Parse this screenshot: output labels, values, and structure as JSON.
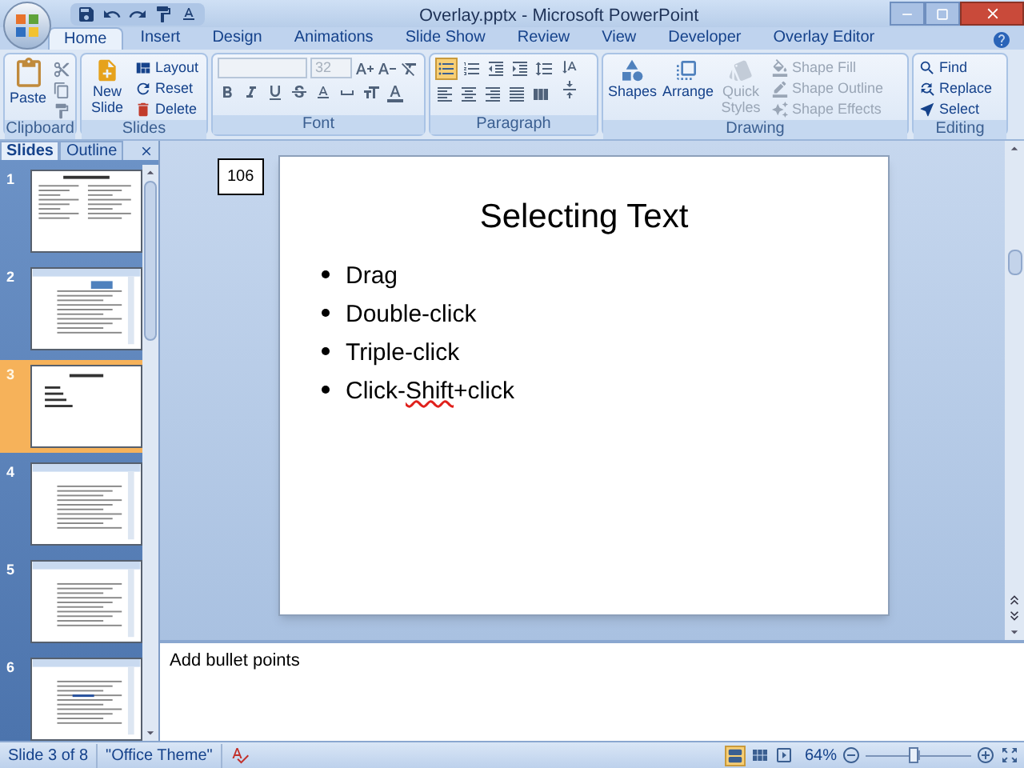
{
  "window": {
    "title": "Overlay.pptx - Microsoft PowerPoint"
  },
  "ribbon_tabs": [
    {
      "label": "Home",
      "selected": true
    },
    {
      "label": "Insert",
      "selected": false
    },
    {
      "label": "Design",
      "selected": false
    },
    {
      "label": "Animations",
      "selected": false
    },
    {
      "label": "Slide Show",
      "selected": false
    },
    {
      "label": "Review",
      "selected": false
    },
    {
      "label": "View",
      "selected": false
    },
    {
      "label": "Developer",
      "selected": false
    },
    {
      "label": "Overlay Editor",
      "selected": false
    }
  ],
  "clipboard": {
    "label": "Clipboard",
    "paste": "Paste"
  },
  "slides_group": {
    "label": "Slides",
    "new_slide": "New Slide",
    "layout": "Layout",
    "reset": "Reset",
    "delete": "Delete"
  },
  "font": {
    "label": "Font",
    "font_size": "32",
    "disabled": true
  },
  "paragraph": {
    "label": "Paragraph"
  },
  "drawing": {
    "label": "Drawing",
    "buttons": [
      {
        "label": "Shapes",
        "disabled": false
      },
      {
        "label": "Arrange",
        "disabled": false
      },
      {
        "label": "Quick Styles",
        "disabled": true
      }
    ],
    "shape_commands": [
      {
        "label": "Shape Fill",
        "disabled": true
      },
      {
        "label": "Shape Outline",
        "disabled": true
      },
      {
        "label": "Shape Effects",
        "disabled": true
      }
    ]
  },
  "editing": {
    "label": "Editing",
    "commands": [
      "Find",
      "Replace",
      "Select"
    ]
  },
  "pane_tabs": [
    {
      "label": "Slides",
      "selected": true
    },
    {
      "label": "Outline",
      "selected": false
    }
  ],
  "thumbnails": [
    {
      "number": "1",
      "kind": "columns",
      "selected": false
    },
    {
      "number": "2",
      "kind": "callout",
      "selected": false
    },
    {
      "number": "3",
      "kind": "bullets",
      "selected": true
    },
    {
      "number": "4",
      "kind": "document",
      "selected": false
    },
    {
      "number": "5",
      "kind": "document",
      "selected": false
    },
    {
      "number": "6",
      "kind": "highlight",
      "selected": false
    }
  ],
  "slide_tag": "106",
  "slide": {
    "title": "Selecting Text",
    "bullets": [
      {
        "parts": [
          {
            "text": "Drag",
            "misspelled": false
          }
        ]
      },
      {
        "parts": [
          {
            "text": "Double-click",
            "misspelled": false
          }
        ]
      },
      {
        "parts": [
          {
            "text": "Triple-click",
            "misspelled": false
          }
        ]
      },
      {
        "parts": [
          {
            "text": "Click-",
            "misspelled": false
          },
          {
            "text": "Shift",
            "misspelled": true
          },
          {
            "text": "+click",
            "misspelled": false
          }
        ]
      }
    ]
  },
  "notes": "Add bullet points",
  "status_bar": {
    "slide": "Slide 3 of 8",
    "theme": "\"Office Theme\"",
    "zoom": "64%",
    "level": 0.45
  }
}
